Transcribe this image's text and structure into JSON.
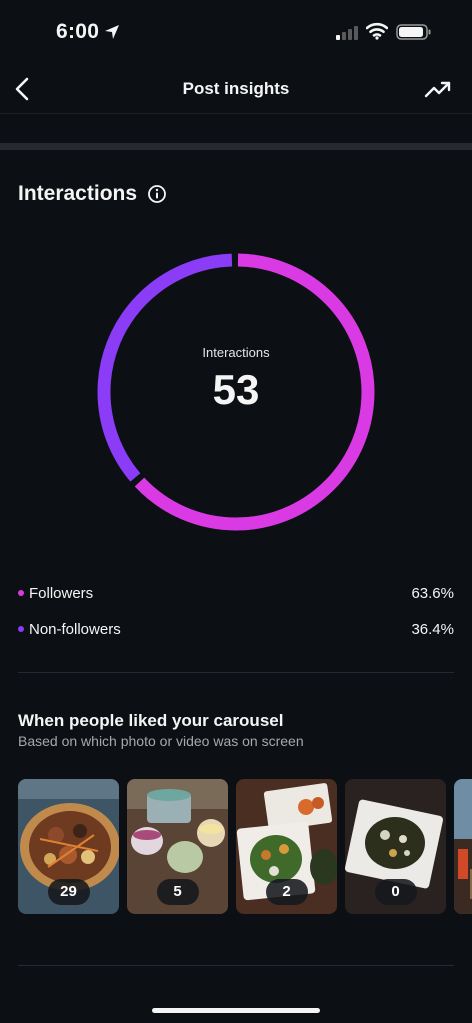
{
  "status_bar": {
    "time": "6:00"
  },
  "nav": {
    "title": "Post insights"
  },
  "interactions": {
    "section_title": "Interactions",
    "donut_label": "Interactions",
    "total": "53",
    "colors": {
      "followers": "#d93ae4",
      "non_followers": "#8a3cf7"
    },
    "legend": [
      {
        "label": "Followers",
        "value": "63.6%"
      },
      {
        "label": "Non-followers",
        "value": "36.4%"
      }
    ]
  },
  "carousel": {
    "title": "When people liked your carousel",
    "subtitle": "Based on which photo or video was on screen",
    "items": [
      {
        "count": "29"
      },
      {
        "count": "5"
      },
      {
        "count": "2"
      },
      {
        "count": "0"
      }
    ]
  }
}
